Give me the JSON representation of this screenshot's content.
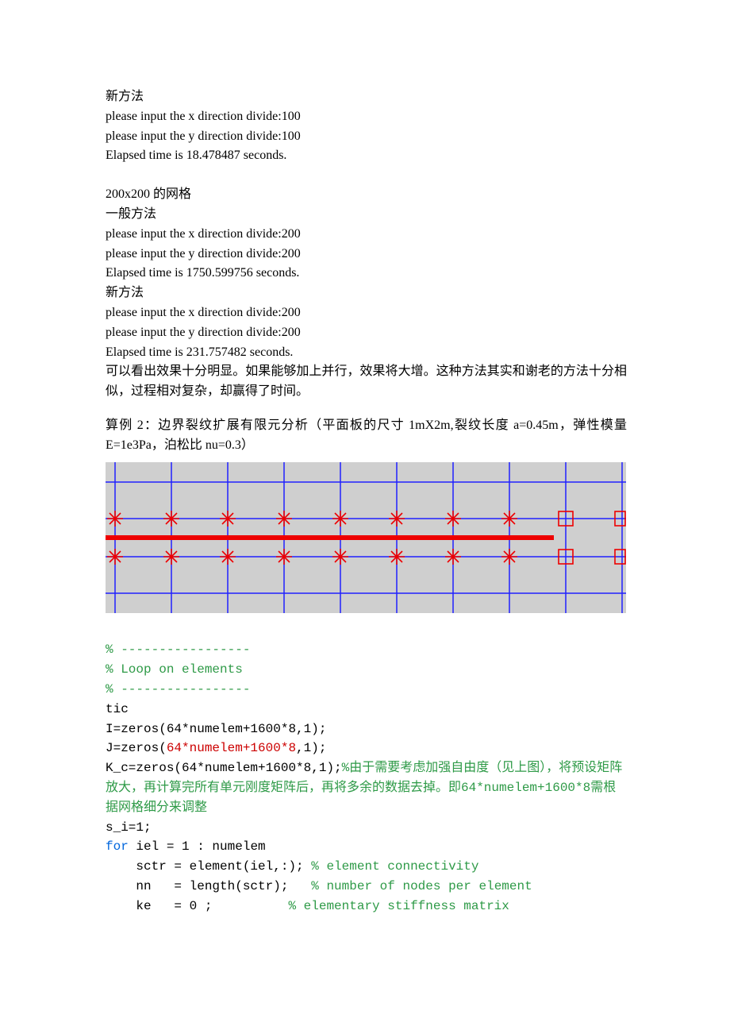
{
  "section1": {
    "heading": "新方法",
    "lines": [
      "please input the x direction divide:100",
      "please input the y direction divide:100",
      "Elapsed time is 18.478487 seconds."
    ]
  },
  "section2": {
    "heading": "200x200 的网格",
    "sub1": "一般方法",
    "lines1": [
      "please input the x direction divide:200",
      "please input the y direction divide:200",
      "Elapsed time is 1750.599756 seconds."
    ],
    "sub2": "新方法",
    "lines2": [
      "please input the x direction divide:200",
      "please input the y direction divide:200",
      "Elapsed time is 231.757482 seconds."
    ],
    "remark": "可以看出效果十分明显。如果能够加上并行，效果将大增。这种方法其实和谢老的方法十分相似，过程相对复杂，却赢得了时间。"
  },
  "example2": {
    "title": "算例 2：边界裂纹扩展有限元分析（平面板的尺寸 1mX2m,裂纹长度 a=0.45m，弹性模量E=1e3Pa，泊松比 nu=0.3）"
  },
  "code": {
    "c1": "% -----------------",
    "c2": "% Loop on elements",
    "c3": "% -----------------",
    "l1": "tic",
    "l2": "I=zeros(64*numelem+1600*8,1);",
    "l3a": "J=zeros(",
    "l3b": "64*numelem+1600*8",
    "l3c": ",1);",
    "l4a": "K_c=zeros(64*numelem+1600*8,1);",
    "l4b": "%由于需要考虑加强自由度（见上图），将预设矩阵放大，再计算完所有单元刚度矩阵后，再将多余的数据去掉。即64*numelem+1600*8需根据网格细分来调整",
    "l5": "s_i=1;",
    "l6a": "for",
    "l6b": " iel = 1 : numelem",
    "l7a": "    sctr = element(iel,:); ",
    "l7b": "% element connectivity",
    "l8a": "    nn   = length(sctr);   ",
    "l8b": "% number of nodes per element",
    "l9a": "    ke   = 0 ;          ",
    "l9b": "% elementary stiffness matrix"
  },
  "chart_data": {
    "type": "diagram",
    "description": "Finite element mesh with crack line",
    "grid": {
      "rows": 4,
      "cols": 10,
      "color": "#2020ff",
      "bg": "#cccccc"
    },
    "crack": {
      "y": 0.5,
      "x_start": 0.0,
      "x_end": 0.86,
      "color": "#ee0000",
      "width": 6
    },
    "enriched_nodes_star": [
      {
        "row": 1,
        "cols": [
          0,
          1,
          2,
          3,
          4,
          5,
          6,
          7
        ]
      },
      {
        "row": 2,
        "cols": [
          0,
          1,
          2,
          3,
          4,
          5,
          6,
          7
        ]
      }
    ],
    "crack_tip_nodes_square": [
      {
        "row": 1,
        "cols": [
          8,
          9
        ]
      },
      {
        "row": 2,
        "cols": [
          8,
          9
        ]
      }
    ],
    "star_color": "#ee0000",
    "square_color": "#ee0000"
  }
}
